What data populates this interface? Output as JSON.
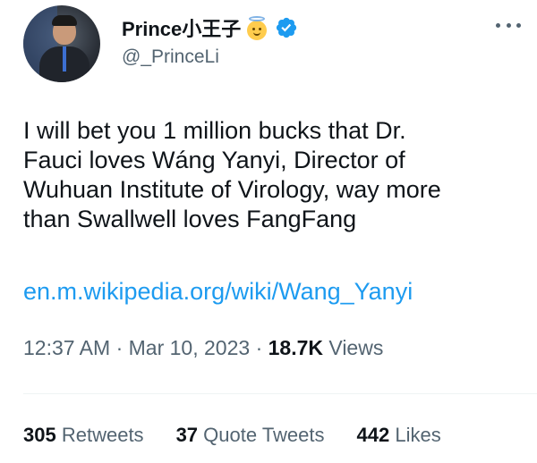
{
  "tweet": {
    "author": {
      "display_name": "Prince小王子",
      "handle": "@_PrinceLi",
      "verified": true,
      "badge_emoji": "angel-face-emoji"
    },
    "text_lines": [
      "I will bet you 1 million bucks that Dr.",
      "Fauci loves Wáng Yanyi, Director of",
      "Wuhuan Institute of Virology, way more",
      "than Swallwell loves FangFang"
    ],
    "link": "en.m.wikipedia.org/wiki/Wang_Yanyi",
    "time": "12:37 AM",
    "sep1": "·",
    "date": "Mar 10, 2023",
    "sep2": "·",
    "views_count": "18.7K",
    "views_label": "Views",
    "stats": {
      "retweets_count": "305",
      "retweets_label": "Retweets",
      "quotes_count": "37",
      "quotes_label": "Quote Tweets",
      "likes_count": "442",
      "likes_label": "Likes"
    }
  },
  "colors": {
    "text_primary": "#0f1419",
    "text_secondary": "#536471",
    "link": "#1d9bf0",
    "verified": "#1d9bf0",
    "divider": "#eff3f4"
  }
}
